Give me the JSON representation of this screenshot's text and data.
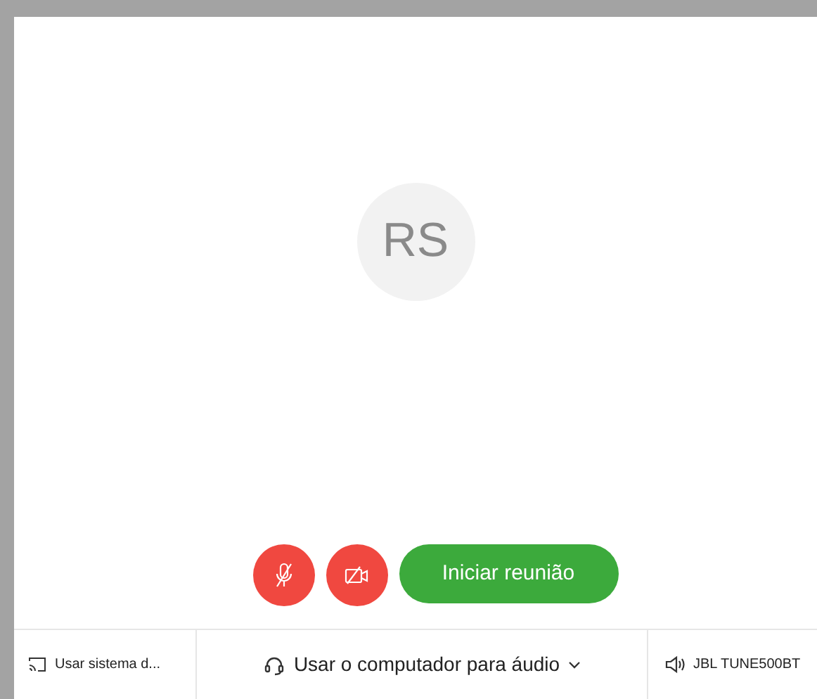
{
  "avatar": {
    "initials": "RS"
  },
  "controls": {
    "mic_muted": true,
    "camera_off": true,
    "start_button": "Iniciar reunião"
  },
  "bottom_bar": {
    "share": "Usar sistema d...",
    "audio": "Usar o computador para áudio",
    "speaker": "JBL TUNE500BT"
  }
}
